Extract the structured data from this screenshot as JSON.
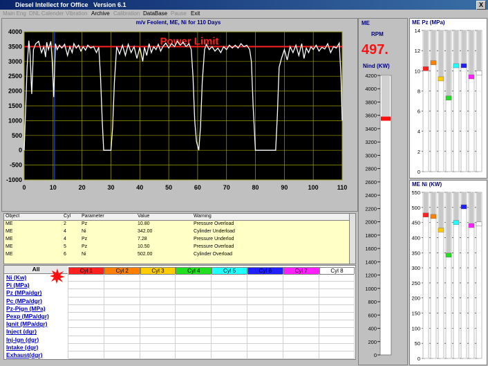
{
  "window": {
    "title": "Diesel Intellect for Office",
    "version": "Version 6.1",
    "close": "X"
  },
  "menu": [
    {
      "label": "Main Eng",
      "enabled": false
    },
    {
      "label": "DNL Calender",
      "enabled": false
    },
    {
      "label": "Vibration",
      "enabled": false
    },
    {
      "label": "Archive",
      "enabled": true
    },
    {
      "label": "Calibration",
      "enabled": false
    },
    {
      "label": "DataBase",
      "enabled": true
    },
    {
      "label": "Pause",
      "enabled": false
    },
    {
      "label": "Exit",
      "enabled": true
    }
  ],
  "chart_data": {
    "type": "line",
    "title": "m/v Feolent,  ME,  Ni  for 110 Days",
    "annotation": "Power Limit",
    "limit": 3500,
    "xlim": [
      0,
      110
    ],
    "ylim": [
      -1000,
      4000
    ],
    "xticks": [
      0,
      10,
      20,
      30,
      40,
      50,
      60,
      70,
      80,
      90,
      100,
      110
    ],
    "yticks": [
      4000,
      3500,
      3000,
      2500,
      2000,
      1500,
      1000,
      500,
      0,
      -500,
      -1000
    ],
    "grid": true,
    "colors": {
      "background": "#000000",
      "line": "#ffffff",
      "limit": "#ff2020",
      "grid": "#a0a000"
    },
    "series": [
      {
        "values": [
          [
            0,
            0
          ],
          [
            1,
            2800
          ],
          [
            1.6,
            3700
          ],
          [
            2,
            3300
          ],
          [
            2.6,
            1900
          ],
          [
            3.2,
            3400
          ],
          [
            4,
            3600
          ],
          [
            5,
            3680
          ],
          [
            6,
            3300
          ],
          [
            6.8,
            3500
          ],
          [
            7.4,
            3150
          ],
          [
            7.8,
            3650
          ],
          [
            8.4,
            3400
          ],
          [
            9.2,
            3680
          ],
          [
            9.7,
            3000
          ],
          [
            10.2,
            1800
          ],
          [
            10.8,
            3600
          ],
          [
            11.4,
            3400
          ],
          [
            12.2,
            3550
          ],
          [
            13,
            3450
          ],
          [
            14,
            3580
          ],
          [
            15,
            3200
          ],
          [
            15.8,
            3500
          ],
          [
            16.6,
            3300
          ],
          [
            17.2,
            3600
          ],
          [
            18,
            3450
          ],
          [
            18.8,
            3550
          ],
          [
            19.6,
            3350
          ],
          [
            20.4,
            3500
          ],
          [
            21.2,
            3380
          ],
          [
            22,
            3550
          ],
          [
            23,
            3450
          ],
          [
            24,
            3500
          ],
          [
            25,
            3300
          ],
          [
            25.8,
            3480
          ],
          [
            26.4,
            2500
          ],
          [
            27,
            1000
          ],
          [
            27.5,
            0
          ],
          [
            30,
            0
          ],
          [
            30.6,
            800
          ],
          [
            31.2,
            2300
          ],
          [
            32,
            3500
          ],
          [
            33,
            3250
          ],
          [
            34,
            3550
          ],
          [
            35,
            3200
          ],
          [
            36,
            3580
          ],
          [
            37,
            3300
          ],
          [
            38,
            3500
          ],
          [
            39,
            3100
          ],
          [
            40,
            3480
          ],
          [
            41,
            3000
          ],
          [
            41.6,
            3480
          ],
          [
            42.4,
            3200
          ],
          [
            43.2,
            3600
          ],
          [
            44,
            3300
          ],
          [
            44.8,
            3500
          ],
          [
            45.6,
            3400
          ],
          [
            46.4,
            3580
          ],
          [
            47.2,
            3350
          ],
          [
            48,
            3500
          ],
          [
            49,
            3620
          ],
          [
            50,
            3450
          ],
          [
            51,
            3600
          ],
          [
            52,
            3500
          ],
          [
            53,
            3680
          ],
          [
            54,
            3550
          ],
          [
            55,
            3650
          ],
          [
            56,
            3500
          ],
          [
            57,
            3600
          ],
          [
            57.8,
            3400
          ],
          [
            58.4,
            2500
          ],
          [
            59,
            1000
          ],
          [
            59.6,
            300
          ],
          [
            60.4,
            0
          ],
          [
            61,
            800
          ],
          [
            61.6,
            2300
          ],
          [
            62.4,
            3400
          ],
          [
            63,
            3580
          ],
          [
            64,
            3400
          ],
          [
            65,
            3500
          ],
          [
            66,
            3350
          ],
          [
            67,
            3450
          ],
          [
            68,
            3300
          ],
          [
            69,
            3500
          ],
          [
            70,
            3400
          ],
          [
            71,
            3550
          ],
          [
            72,
            3450
          ],
          [
            73,
            3550
          ],
          [
            74,
            3450
          ],
          [
            75,
            3600
          ],
          [
            76,
            3500
          ],
          [
            77,
            3550
          ],
          [
            78,
            3400
          ],
          [
            78.6,
            3000
          ],
          [
            79.2,
            1500
          ],
          [
            80,
            0
          ],
          [
            87,
            0
          ],
          [
            87.6,
            1200
          ],
          [
            88.2,
            2800
          ],
          [
            89,
            3100
          ],
          [
            90,
            3400
          ],
          [
            91,
            3050
          ],
          [
            92,
            3500
          ],
          [
            93,
            3300
          ],
          [
            94,
            3550
          ],
          [
            95,
            3200
          ],
          [
            96,
            3600
          ],
          [
            96.8,
            3100
          ],
          [
            97.6,
            3450
          ],
          [
            98.4,
            3300
          ],
          [
            99.2,
            3500
          ],
          [
            100,
            3400
          ],
          [
            101,
            3550
          ],
          [
            102,
            3350
          ],
          [
            103,
            3480
          ],
          [
            104,
            3420
          ],
          [
            105,
            3600
          ],
          [
            106,
            3300
          ],
          [
            107,
            3500
          ],
          [
            108,
            3450
          ],
          [
            109,
            3620
          ],
          [
            109.6,
            2500
          ],
          [
            110,
            1000
          ]
        ]
      }
    ]
  },
  "table": {
    "headers": [
      "Object",
      "Cyl",
      "Parameter",
      "Value",
      "Warning"
    ],
    "rows": [
      [
        "ME",
        "2",
        "Pz",
        "10.80",
        "Pressure Overload"
      ],
      [
        "ME",
        "4",
        "Ni",
        "342.00",
        "Cylinder Underload"
      ],
      [
        "ME",
        "4",
        "Pz",
        "7.28",
        "Pressure Underlod"
      ],
      [
        "ME",
        "5",
        "Pz",
        "10.50",
        "Pressure Overload"
      ],
      [
        "ME",
        "6",
        "Ni",
        "502.00",
        "Cylinder Overload"
      ]
    ]
  },
  "params": {
    "all_label": "All",
    "labels": [
      "Ni    (Kw)",
      "Pi    (MPa)",
      "Pz     (MPa/dgr)",
      "Pc     (MPa/dgr)",
      "Pz-Pign    (MPa)",
      "Pexp    (MPa/dgr)",
      "Ignit  (MPa/dgr)",
      "Inject (dgr)",
      "Inj-Ign  (dgr)",
      "Intake (dgr)",
      "Exhaust(dgr)"
    ],
    "cylinders": [
      {
        "label": "Cyl 1",
        "color": "#ff2020"
      },
      {
        "label": "Cyl 2",
        "color": "#ff8000"
      },
      {
        "label": "Cyl 3",
        "color": "#ffcc00"
      },
      {
        "label": "Cyl 4",
        "color": "#20e020"
      },
      {
        "label": "Cyl 5",
        "color": "#20ffff"
      },
      {
        "label": "Cyl 6",
        "color": "#2020ff"
      },
      {
        "label": "Cyl 7",
        "color": "#ff20ff"
      },
      {
        "label": "Cyl 8",
        "color": "#ffffff"
      }
    ]
  },
  "me": {
    "title": "ME",
    "rpm_label": "RPM",
    "rpm_value": "497.",
    "nind_label": "Nind (KW)",
    "nind_value": 3550,
    "scale": [
      4200,
      4000,
      3800,
      3600,
      3400,
      3200,
      3000,
      2800,
      2600,
      2400,
      2200,
      2000,
      1800,
      1600,
      1400,
      1200,
      1000,
      800,
      600,
      400,
      200,
      0
    ]
  },
  "pz": {
    "title": "ME Pz  (MPa)",
    "scale": [
      14,
      12,
      10,
      8,
      6,
      4,
      2,
      0
    ],
    "values": [
      10.2,
      10.8,
      9.2,
      7.3,
      10.5,
      10.5,
      9.4,
      9.8
    ]
  },
  "ni": {
    "title": "ME Ni  (KW)",
    "scale": [
      550,
      500,
      450,
      400,
      350,
      300,
      250,
      200,
      150,
      100,
      50,
      0
    ],
    "values": [
      475,
      470,
      425,
      342,
      450,
      502,
      440,
      445
    ]
  }
}
